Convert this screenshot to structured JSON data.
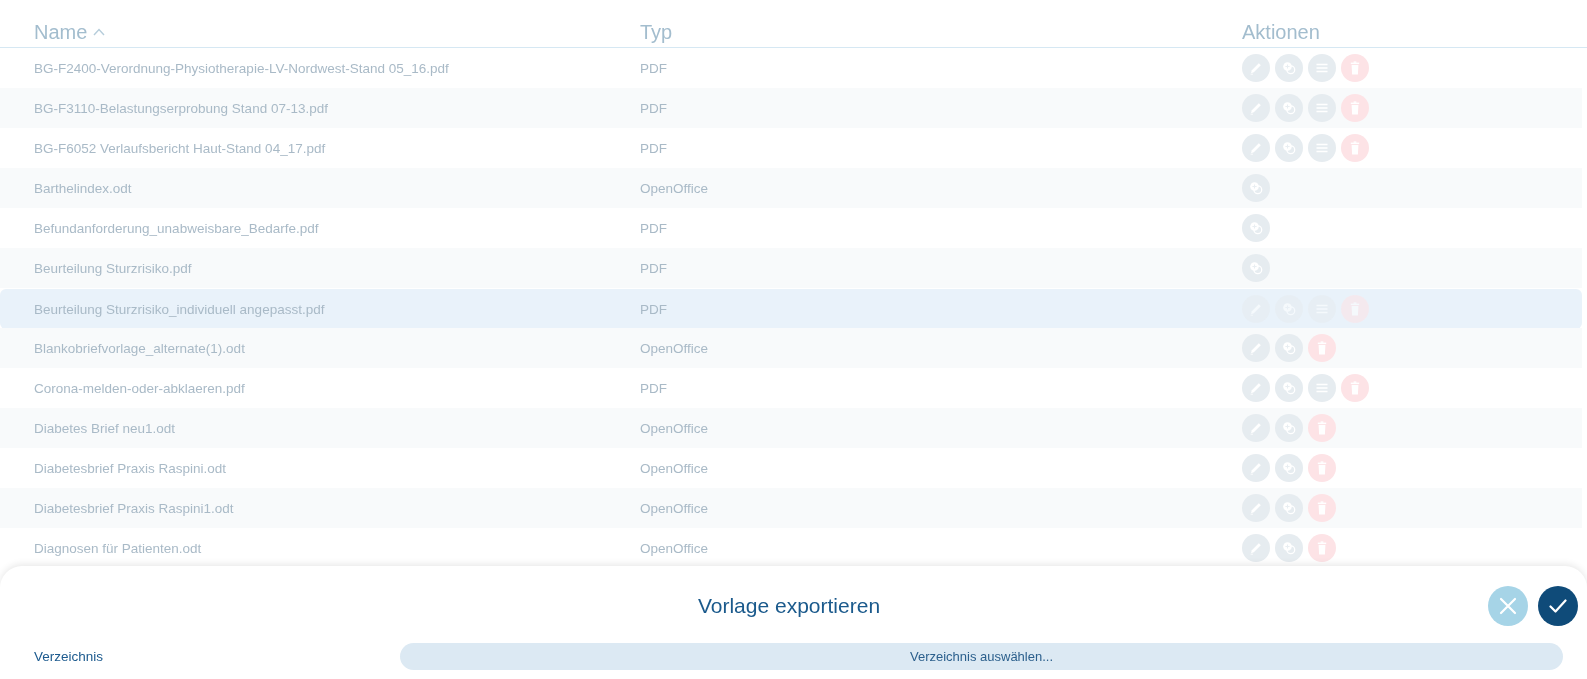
{
  "table": {
    "columns": [
      {
        "label": "Name",
        "sorted": true
      },
      {
        "label": "Typ",
        "sorted": false
      },
      {
        "label": "Aktionen",
        "sorted": false
      }
    ],
    "rows": [
      {
        "name": "BG-F2400-Verordnung-Physiotherapie-LV-Nordwest-Stand 05_16.pdf",
        "type": "PDF",
        "selected": false,
        "actions": [
          {
            "kind": "edit"
          },
          {
            "kind": "duplicate"
          },
          {
            "kind": "list"
          },
          {
            "kind": "delete"
          }
        ]
      },
      {
        "name": "BG-F3110-Belastungserprobung Stand 07-13.pdf",
        "type": "PDF",
        "selected": false,
        "actions": [
          {
            "kind": "edit"
          },
          {
            "kind": "duplicate"
          },
          {
            "kind": "list"
          },
          {
            "kind": "delete"
          }
        ]
      },
      {
        "name": "BG-F6052 Verlaufsbericht Haut-Stand 04_17.pdf",
        "type": "PDF",
        "selected": false,
        "actions": [
          {
            "kind": "edit"
          },
          {
            "kind": "duplicate"
          },
          {
            "kind": "list"
          },
          {
            "kind": "delete"
          }
        ]
      },
      {
        "name": "Barthelindex.odt",
        "type": "OpenOffice",
        "selected": false,
        "actions": [
          {
            "kind": "duplicate"
          }
        ]
      },
      {
        "name": "Befundanforderung_unabweisbare_Bedarfe.pdf",
        "type": "PDF",
        "selected": false,
        "actions": [
          {
            "kind": "duplicate"
          }
        ]
      },
      {
        "name": "Beurteilung Sturzrisiko.pdf",
        "type": "PDF",
        "selected": false,
        "actions": [
          {
            "kind": "duplicate"
          }
        ]
      },
      {
        "name": "Beurteilung Sturzrisiko_individuell angepasst.pdf",
        "type": "PDF",
        "selected": true,
        "actions": [
          {
            "kind": "edit"
          },
          {
            "kind": "duplicate"
          },
          {
            "kind": "list"
          },
          {
            "kind": "delete"
          }
        ]
      },
      {
        "name": "Blankobriefvorlage_alternate(1).odt",
        "type": "OpenOffice",
        "selected": false,
        "actions": [
          {
            "kind": "edit"
          },
          {
            "kind": "duplicate"
          },
          {
            "kind": "delete"
          }
        ]
      },
      {
        "name": "Corona-melden-oder-abklaeren.pdf",
        "type": "PDF",
        "selected": false,
        "actions": [
          {
            "kind": "edit"
          },
          {
            "kind": "duplicate"
          },
          {
            "kind": "list"
          },
          {
            "kind": "delete"
          }
        ]
      },
      {
        "name": "Diabetes Brief neu1.odt",
        "type": "OpenOffice",
        "selected": false,
        "actions": [
          {
            "kind": "edit"
          },
          {
            "kind": "duplicate"
          },
          {
            "kind": "delete"
          }
        ]
      },
      {
        "name": "Diabetesbrief Praxis Raspini.odt",
        "type": "OpenOffice",
        "selected": false,
        "actions": [
          {
            "kind": "edit"
          },
          {
            "kind": "duplicate"
          },
          {
            "kind": "delete"
          }
        ]
      },
      {
        "name": "Diabetesbrief Praxis Raspini1.odt",
        "type": "OpenOffice",
        "selected": false,
        "actions": [
          {
            "kind": "edit"
          },
          {
            "kind": "duplicate"
          },
          {
            "kind": "delete"
          }
        ]
      },
      {
        "name": "Diagnosen für Patienten.odt",
        "type": "OpenOffice",
        "selected": false,
        "actions": [
          {
            "kind": "edit"
          },
          {
            "kind": "duplicate"
          },
          {
            "kind": "delete"
          }
        ]
      }
    ]
  },
  "dialog": {
    "title": "Vorlage exportieren",
    "fields": [
      {
        "label": "Verzeichnis",
        "button": "Verzeichnis auswählen..."
      }
    ]
  }
}
